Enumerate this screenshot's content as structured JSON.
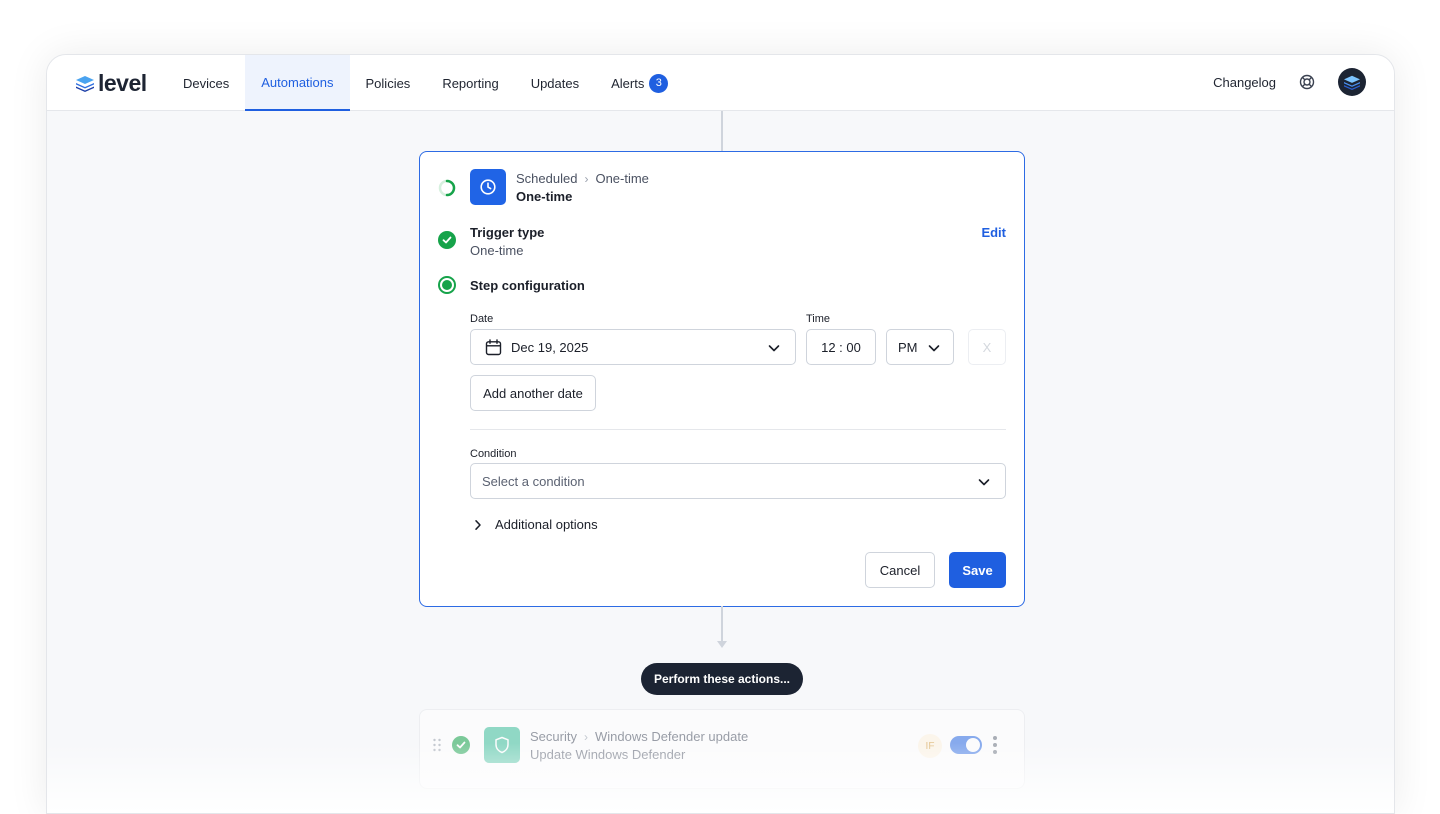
{
  "brand": {
    "name": "level"
  },
  "nav": {
    "items": [
      {
        "label": "Devices",
        "active": false
      },
      {
        "label": "Automations",
        "active": true
      },
      {
        "label": "Policies",
        "active": false
      },
      {
        "label": "Reporting",
        "active": false
      },
      {
        "label": "Updates",
        "active": false
      },
      {
        "label": "Alerts",
        "active": false,
        "badge": "3"
      }
    ],
    "changelog": "Changelog",
    "help_icon": "lifebuoy-icon",
    "avatar_icon": "layers-icon"
  },
  "trigger_card": {
    "crumb_parent": "Scheduled",
    "crumb_child": "One-time",
    "subtitle": "One-time",
    "trigger_type_title": "Trigger type",
    "trigger_type_value": "One-time",
    "edit_label": "Edit",
    "step_config_title": "Step configuration",
    "date_label": "Date",
    "date_value": "Dec 19, 2025",
    "time_label": "Time",
    "time_value": "12 : 00",
    "ampm_value": "PM",
    "remove_label": "X",
    "add_date_label": "Add another date",
    "condition_label": "Condition",
    "condition_placeholder": "Select a condition",
    "additional_options": "Additional options",
    "cancel_label": "Cancel",
    "save_label": "Save"
  },
  "perform_label": "Perform these actions...",
  "action_card": {
    "crumb_parent": "Security",
    "crumb_child": "Windows Defender update",
    "subtitle": "Update Windows Defender",
    "if_badge": "IF",
    "enabled": true
  },
  "colors": {
    "accent": "#1f5fe0",
    "success": "#16a34a",
    "dark": "#1c2433"
  }
}
